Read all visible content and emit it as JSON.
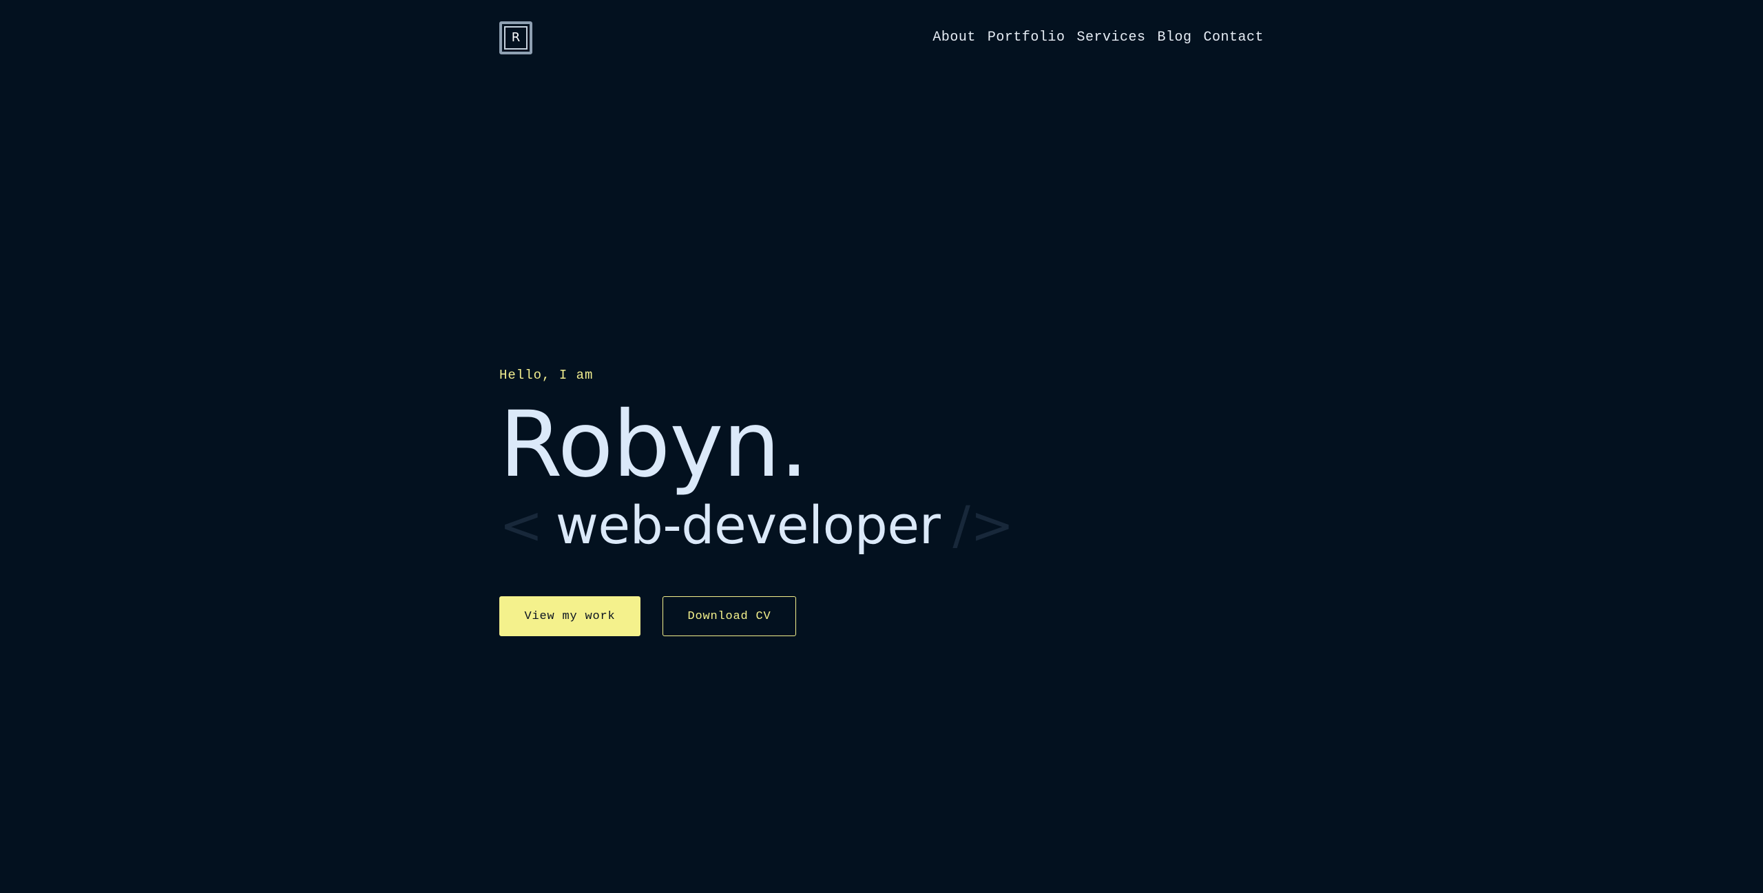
{
  "header": {
    "logo_letter": "R",
    "nav": [
      {
        "label": "About"
      },
      {
        "label": "Portfolio"
      },
      {
        "label": "Services"
      },
      {
        "label": "Blog"
      },
      {
        "label": "Contact"
      }
    ]
  },
  "hero": {
    "greeting": "Hello, I am",
    "name": "Robyn.",
    "role_open": "<",
    "role": "web-developer",
    "role_close": "/>",
    "primary_button": "View my work",
    "secondary_button": "Download CV"
  },
  "colors": {
    "background": "#03111f",
    "accent": "#f4f18c",
    "heading": "#dbe9f9",
    "bracket": "#18283a"
  }
}
